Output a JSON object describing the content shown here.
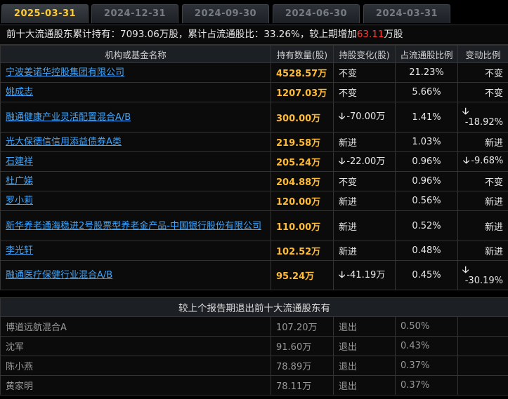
{
  "tabs": [
    "2025-03-31",
    "2024-12-31",
    "2024-09-30",
    "2024-06-30",
    "2024-03-31"
  ],
  "summary": {
    "p1": "前十大流通股东累计持有：",
    "total": "7093.06万股",
    "p2": "，累计占流通股比：",
    "ratio": "33.26%",
    "p3": "，较上期增加",
    "inc": "63.11",
    "unit": "万股"
  },
  "headers": {
    "name": "机构或基金名称",
    "amount": "持有数量(股)",
    "change": "持股变化(股)",
    "ratio": "占流通股比例",
    "vratio": "变动比例"
  },
  "rows": [
    {
      "name": "宁波姜诺华控股集团有限公司",
      "amount": "4528.57万",
      "change": "不变",
      "change_type": "same",
      "ratio": "21.23%",
      "vratio": "不变",
      "vratio_type": "same"
    },
    {
      "name": "姚成志",
      "amount": "1207.03万",
      "change": "不变",
      "change_type": "same",
      "ratio": "5.66%",
      "vratio": "不变",
      "vratio_type": "same"
    },
    {
      "name": "融通健康产业灵活配置混合A/B",
      "amount": "300.00万",
      "change": "-70.00万",
      "change_type": "down",
      "ratio": "1.41%",
      "vratio": "-18.92%",
      "vratio_type": "down"
    },
    {
      "name": "光大保德信信用添益债券A类",
      "amount": "219.58万",
      "change": "新进",
      "change_type": "new",
      "ratio": "1.03%",
      "vratio": "新进",
      "vratio_type": "new"
    },
    {
      "name": "石建祥",
      "amount": "205.24万",
      "change": "-22.00万",
      "change_type": "down",
      "ratio": "0.96%",
      "vratio": "-9.68%",
      "vratio_type": "down-inline"
    },
    {
      "name": "杜广娣",
      "amount": "204.88万",
      "change": "不变",
      "change_type": "same",
      "ratio": "0.96%",
      "vratio": "不变",
      "vratio_type": "same"
    },
    {
      "name": "罗小莉",
      "amount": "120.00万",
      "change": "新进",
      "change_type": "new",
      "ratio": "0.56%",
      "vratio": "新进",
      "vratio_type": "new"
    },
    {
      "name": "新华养老通海稳进2号股票型养老金产品-中国银行股份有限公司",
      "amount": "110.00万",
      "change": "新进",
      "change_type": "new",
      "ratio": "0.52%",
      "vratio": "新进",
      "vratio_type": "new"
    },
    {
      "name": "李光轩",
      "amount": "102.52万",
      "change": "新进",
      "change_type": "new",
      "ratio": "0.48%",
      "vratio": "新进",
      "vratio_type": "new"
    },
    {
      "name": "融通医疗保健行业混合A/B",
      "amount": "95.24万",
      "change": "-41.19万",
      "change_type": "down",
      "ratio": "0.45%",
      "vratio": "-30.19%",
      "vratio_type": "down"
    }
  ],
  "exit": {
    "title": "较上个报告期退出前十大流通股东有",
    "rows": [
      {
        "name": "博道远航混合A",
        "amount": "107.20万",
        "status": "退出",
        "ratio": "0.50%"
      },
      {
        "name": "沈军",
        "amount": "91.60万",
        "status": "退出",
        "ratio": "0.43%"
      },
      {
        "name": "陈小燕",
        "amount": "78.89万",
        "status": "退出",
        "ratio": "0.37%"
      },
      {
        "name": "黄家明",
        "amount": "78.11万",
        "status": "退出",
        "ratio": "0.37%"
      }
    ]
  },
  "colors": {
    "accent": "#ffcc33",
    "link": "#3da6ff",
    "up": "#ff3b3b",
    "down": "#33cc33",
    "amount": "#ffbb33"
  },
  "icons": {
    "down": "arrow-down-icon"
  }
}
